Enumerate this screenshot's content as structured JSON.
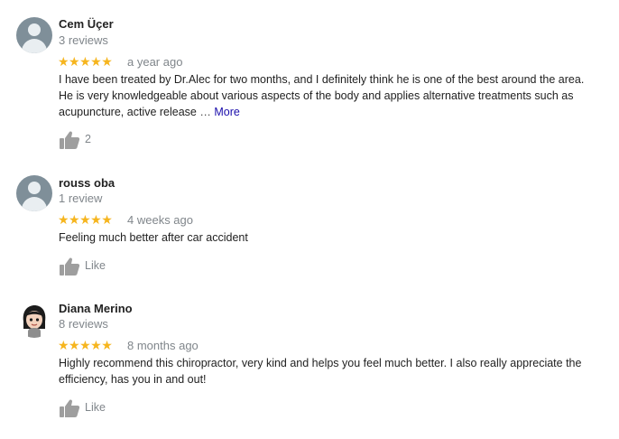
{
  "reviews": [
    {
      "name": "Cem Üçer",
      "review_count": "3 reviews",
      "rating": 5,
      "stars": "★★★★★",
      "time": "a year ago",
      "text": "I have been treated by Dr.Alec for two months, and I definitely think he is one of the best around the area. He is very knowledgeable about various aspects of the body and applies alternative treatments such as acupuncture, active release",
      "ellipsis": "…",
      "more_label": "More",
      "like_label": "2",
      "avatar": "default-avatar"
    },
    {
      "name": "rouss oba",
      "review_count": "1 review",
      "rating": 5,
      "stars": "★★★★★",
      "time": "4 weeks ago",
      "text": "Feeling much better after car accident",
      "like_label": "Like",
      "avatar": "default-avatar"
    },
    {
      "name": "Diana Merino",
      "review_count": "8 reviews",
      "rating": 5,
      "stars": "★★★★★",
      "time": "8 months ago",
      "text": "Highly recommend this chiropractor, very kind and helps you feel much better. I also really appreciate the efficiency, has you in and out!",
      "like_label": "Like",
      "avatar": "cartoon-girl-avatar"
    }
  ],
  "colors": {
    "star": "#f6b51e",
    "secondary_text": "#80868b",
    "link": "#1a0dab",
    "thumb": "#9e9e9e"
  }
}
